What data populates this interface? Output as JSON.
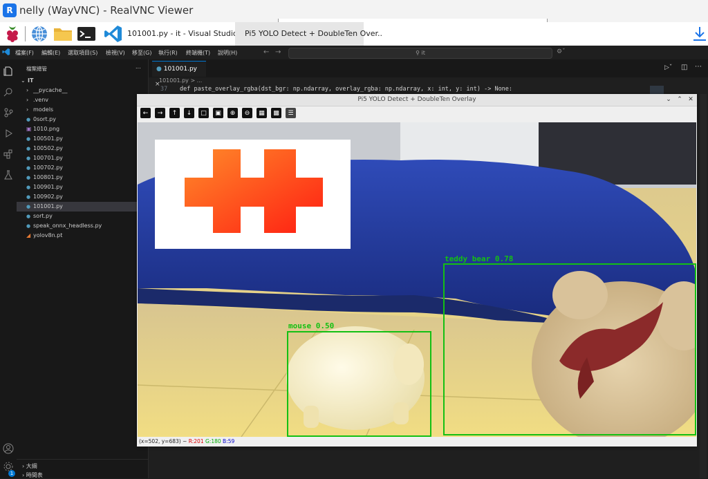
{
  "vnc": {
    "title": "nelly (WayVNC) - RealVNC Viewer",
    "logo": "R"
  },
  "taskbar": {
    "icons": [
      "raspberry-icon",
      "globe-icon",
      "folder-icon",
      "terminal-icon",
      "vscode-icon"
    ],
    "tasks": [
      "101001.py - it - Visual Studio C..",
      "Pi5 YOLO Detect + DoubleTen Over.."
    ],
    "download_icon": "download-icon"
  },
  "vscode": {
    "menu": [
      "檔案(F)",
      "編輯(E)",
      "選取項目(S)",
      "檢視(V)",
      "移至(G)",
      "執行(R)",
      "終端機(T)",
      "說明(H)"
    ],
    "search": "it",
    "explorer_title": "檔案總管",
    "explorer_more": "...",
    "tree": [
      {
        "label": "IT",
        "indent": 0,
        "kind": "root"
      },
      {
        "label": "__pycache__",
        "indent": 1,
        "kind": "folder"
      },
      {
        "label": ".venv",
        "indent": 1,
        "kind": "folder"
      },
      {
        "label": "models",
        "indent": 1,
        "kind": "folder"
      },
      {
        "label": "0sort.py",
        "indent": 1,
        "kind": "py"
      },
      {
        "label": "1010.png",
        "indent": 1,
        "kind": "png"
      },
      {
        "label": "100501.py",
        "indent": 1,
        "kind": "py"
      },
      {
        "label": "100502.py",
        "indent": 1,
        "kind": "py"
      },
      {
        "label": "100701.py",
        "indent": 1,
        "kind": "py"
      },
      {
        "label": "100702.py",
        "indent": 1,
        "kind": "py"
      },
      {
        "label": "100801.py",
        "indent": 1,
        "kind": "py"
      },
      {
        "label": "100901.py",
        "indent": 1,
        "kind": "py"
      },
      {
        "label": "100902.py",
        "indent": 1,
        "kind": "py"
      },
      {
        "label": "101001.py",
        "indent": 1,
        "kind": "py",
        "selected": true
      },
      {
        "label": "sort.py",
        "indent": 1,
        "kind": "py"
      },
      {
        "label": "speak_onnx_headless.py",
        "indent": 1,
        "kind": "py"
      },
      {
        "label": "yolov8n.pt",
        "indent": 1,
        "kind": "rss"
      }
    ],
    "tab": "101001.py",
    "breadcrumb": "101001.py > ...",
    "line_number": "37",
    "code": "def paste_overlay_rgba(dst_bgr: np.ndarray, overlay_rgba: np.ndarray, x: int, y: int) -> None:",
    "outline": "大綱",
    "timeline": "時間表",
    "badge": "1"
  },
  "viewer": {
    "title": "Pi5 YOLO Detect + DoubleTen Overlay",
    "tools": [
      "left-arrow-icon",
      "right-arrow-icon",
      "up-arrow-icon",
      "down-arrow-icon",
      "zoom-fit-icon",
      "image-icon",
      "zoom-in-icon",
      "zoom-out-icon",
      "save-icon",
      "copy-icon",
      "settings-icon"
    ],
    "status": {
      "coords": "(x=502, y=683) ~",
      "r": "R:201",
      "g": "G:180",
      "b": "B:59"
    },
    "detections": [
      {
        "label": "teddy bear 0.78"
      },
      {
        "label": "mouse 0.50"
      }
    ]
  },
  "colors": {
    "detect": "#13c013",
    "vsc_accent": "#0078d4",
    "overlay_from": "#ff8a2a",
    "overlay_to": "#ff1e12"
  }
}
